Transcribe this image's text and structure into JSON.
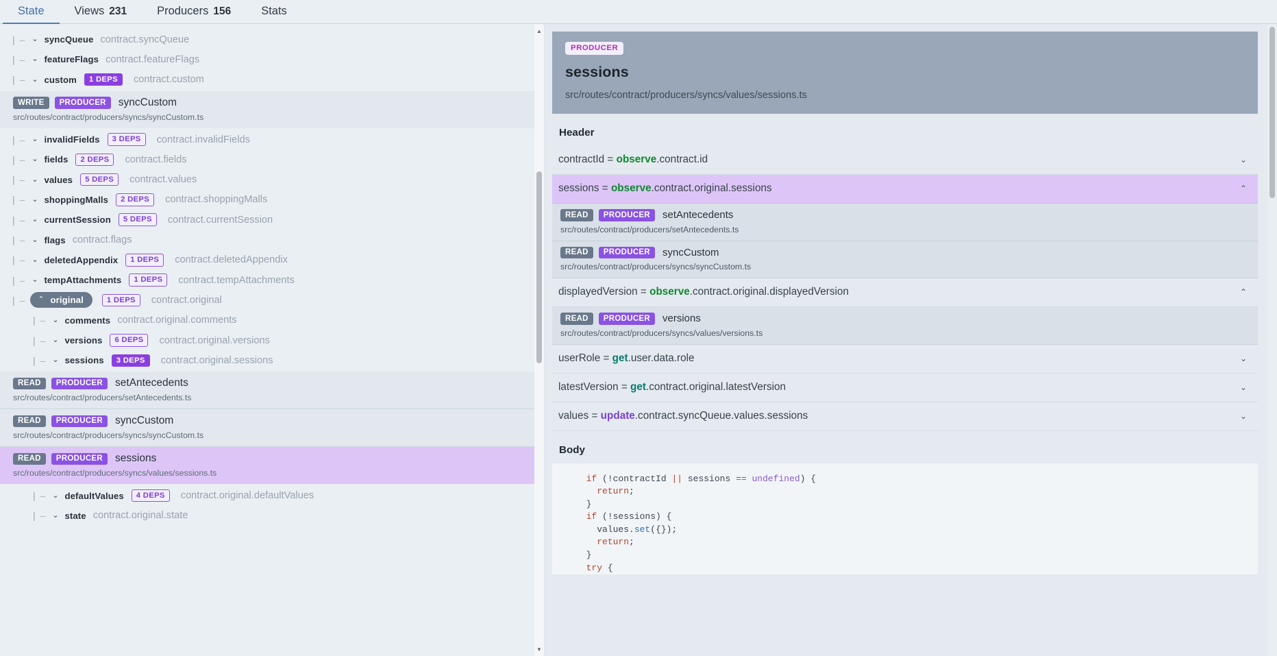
{
  "tabs": [
    {
      "label": "State",
      "count": "",
      "active": true
    },
    {
      "label": "Views",
      "count": "231",
      "active": false
    },
    {
      "label": "Producers",
      "count": "156",
      "active": false
    },
    {
      "label": "Stats",
      "count": "",
      "active": false
    }
  ],
  "tree": {
    "rows": [
      {
        "kind": "node",
        "name": "syncQueue",
        "path": "contract.syncQueue",
        "chevron": "chevron-down",
        "deps": "",
        "deps_style": "",
        "depth": 0,
        "selected": false
      },
      {
        "kind": "node",
        "name": "featureFlags",
        "path": "contract.featureFlags",
        "chevron": "chevron-down",
        "deps": "",
        "deps_style": "",
        "depth": 0,
        "selected": false
      },
      {
        "kind": "node",
        "name": "custom",
        "path": "contract.custom",
        "chevron": "chevron-down",
        "deps": "1 DEPS",
        "deps_style": "fill",
        "depth": 0,
        "selected": false
      },
      {
        "kind": "cards",
        "cards": [
          {
            "access": "WRITE",
            "role": "PRODUCER",
            "name": "syncCustom",
            "path": "src/routes/contract/producers/syncs/syncCustom.ts",
            "selected": false
          }
        ]
      },
      {
        "kind": "node",
        "name": "invalidFields",
        "path": "contract.invalidFields",
        "chevron": "chevron-down",
        "deps": "3 DEPS",
        "deps_style": "out",
        "depth": 0,
        "selected": false
      },
      {
        "kind": "node",
        "name": "fields",
        "path": "contract.fields",
        "chevron": "chevron-down",
        "deps": "2 DEPS",
        "deps_style": "out",
        "depth": 0,
        "selected": false
      },
      {
        "kind": "node",
        "name": "values",
        "path": "contract.values",
        "chevron": "chevron-down",
        "deps": "5 DEPS",
        "deps_style": "out",
        "depth": 0,
        "selected": false
      },
      {
        "kind": "node",
        "name": "shoppingMalls",
        "path": "contract.shoppingMalls",
        "chevron": "chevron-down",
        "deps": "2 DEPS",
        "deps_style": "out",
        "depth": 0,
        "selected": false
      },
      {
        "kind": "node",
        "name": "currentSession",
        "path": "contract.currentSession",
        "chevron": "chevron-down",
        "deps": "5 DEPS",
        "deps_style": "out",
        "depth": 0,
        "selected": false
      },
      {
        "kind": "node",
        "name": "flags",
        "path": "contract.flags",
        "chevron": "chevron-down",
        "deps": "",
        "deps_style": "",
        "depth": 0,
        "selected": false
      },
      {
        "kind": "node",
        "name": "deletedAppendix",
        "path": "contract.deletedAppendix",
        "chevron": "chevron-down",
        "deps": "1 DEPS",
        "deps_style": "out",
        "depth": 0,
        "selected": false
      },
      {
        "kind": "node",
        "name": "tempAttachments",
        "path": "contract.tempAttachments",
        "chevron": "chevron-down",
        "deps": "1 DEPS",
        "deps_style": "out",
        "depth": 0,
        "selected": false
      },
      {
        "kind": "node",
        "name": "original",
        "path": "contract.original",
        "chevron": "chevron-up",
        "deps": "1 DEPS",
        "deps_style": "out",
        "depth": 0,
        "selected": true
      },
      {
        "kind": "node",
        "name": "comments",
        "path": "contract.original.comments",
        "chevron": "chevron-down",
        "deps": "",
        "deps_style": "",
        "depth": 1,
        "selected": false
      },
      {
        "kind": "node",
        "name": "versions",
        "path": "contract.original.versions",
        "chevron": "chevron-down",
        "deps": "6 DEPS",
        "deps_style": "out",
        "depth": 1,
        "selected": false
      },
      {
        "kind": "node",
        "name": "sessions",
        "path": "contract.original.sessions",
        "chevron": "chevron-down",
        "deps": "3 DEPS",
        "deps_style": "fill",
        "depth": 1,
        "selected": false
      },
      {
        "kind": "cards",
        "cards": [
          {
            "access": "READ",
            "role": "PRODUCER",
            "name": "setAntecedents",
            "path": "src/routes/contract/producers/setAntecedents.ts",
            "selected": false
          },
          {
            "access": "READ",
            "role": "PRODUCER",
            "name": "syncCustom",
            "path": "src/routes/contract/producers/syncs/syncCustom.ts",
            "selected": false
          },
          {
            "access": "READ",
            "role": "PRODUCER",
            "name": "sessions",
            "path": "src/routes/contract/producers/syncs/values/sessions.ts",
            "selected": true
          }
        ]
      },
      {
        "kind": "node",
        "name": "defaultValues",
        "path": "contract.original.defaultValues",
        "chevron": "chevron-down",
        "deps": "4 DEPS",
        "deps_style": "out",
        "depth": 1,
        "selected": false
      },
      {
        "kind": "node",
        "name": "state",
        "path": "contract.original.state",
        "chevron": "chevron-down",
        "deps": "",
        "deps_style": "",
        "depth": 1,
        "selected": false
      }
    ]
  },
  "detail": {
    "badge": "PRODUCER",
    "title": "sessions",
    "subtitle": "src/routes/contract/producers/syncs/values/sessions.ts",
    "header_section_title": "Header",
    "header_rows": [
      {
        "var": "contractId",
        "eq": "=",
        "keyword": "observe",
        "keyword_kind": "observe",
        "tail": ".contract.id",
        "caret": "chevron-down",
        "expanded": false,
        "highlighted": false,
        "producers": []
      },
      {
        "var": "sessions",
        "eq": "=",
        "keyword": "observe",
        "keyword_kind": "observe",
        "tail": ".contract.original.sessions",
        "caret": "chevron-up",
        "expanded": true,
        "highlighted": true,
        "producers": [
          {
            "access": "READ",
            "role": "PRODUCER",
            "name": "setAntecedents",
            "path": "src/routes/contract/producers/setAntecedents.ts",
            "highlighted": false
          },
          {
            "access": "READ",
            "role": "PRODUCER",
            "name": "syncCustom",
            "path": "src/routes/contract/producers/syncs/syncCustom.ts",
            "highlighted": false
          }
        ]
      },
      {
        "var": "displayedVersion",
        "eq": "=",
        "keyword": "observe",
        "keyword_kind": "observe",
        "tail": ".contract.original.displayedVersion",
        "caret": "chevron-up",
        "expanded": true,
        "highlighted": false,
        "producers": [
          {
            "access": "READ",
            "role": "PRODUCER",
            "name": "versions",
            "path": "src/routes/contract/producers/syncs/values/versions.ts",
            "highlighted": false
          }
        ]
      },
      {
        "var": "userRole",
        "eq": "=",
        "keyword": "get",
        "keyword_kind": "get",
        "tail": ".user.data.role",
        "caret": "chevron-down",
        "expanded": false,
        "highlighted": false,
        "producers": []
      },
      {
        "var": "latestVersion",
        "eq": "=",
        "keyword": "get",
        "keyword_kind": "get",
        "tail": ".contract.original.latestVersion",
        "caret": "chevron-down",
        "expanded": false,
        "highlighted": false,
        "producers": []
      },
      {
        "var": "values",
        "eq": "=",
        "keyword": "update",
        "keyword_kind": "update",
        "tail": ".contract.syncQueue.values.sessions",
        "caret": "chevron-down",
        "expanded": false,
        "highlighted": false,
        "producers": []
      }
    ],
    "body_section_title": "Body",
    "code_lines": [
      [
        {
          "t": "  ",
          "c": "pl"
        },
        {
          "t": "if",
          "c": "kw"
        },
        {
          "t": " (!contractId ",
          "c": "pl"
        },
        {
          "t": "||",
          "c": "kw"
        },
        {
          "t": " sessions ",
          "c": "pl"
        },
        {
          "t": "==",
          "c": "kw"
        },
        {
          "t": " ",
          "c": "pl"
        },
        {
          "t": "undefined",
          "c": "num"
        },
        {
          "t": ") {",
          "c": "pl"
        }
      ],
      [
        {
          "t": "    ",
          "c": "pl"
        },
        {
          "t": "return",
          "c": "kw"
        },
        {
          "t": ";",
          "c": "pl"
        }
      ],
      [
        {
          "t": "  }",
          "c": "pl"
        }
      ],
      [
        {
          "t": "  ",
          "c": "pl"
        },
        {
          "t": "if",
          "c": "kw"
        },
        {
          "t": " (!sessions) {",
          "c": "pl"
        }
      ],
      [
        {
          "t": "    values.",
          "c": "pl"
        },
        {
          "t": "set",
          "c": "fn"
        },
        {
          "t": "({});",
          "c": "pl"
        }
      ],
      [
        {
          "t": "    ",
          "c": "pl"
        },
        {
          "t": "return",
          "c": "kw"
        },
        {
          "t": ";",
          "c": "pl"
        }
      ],
      [
        {
          "t": "  }",
          "c": "pl"
        }
      ],
      [
        {
          "t": "  ",
          "c": "pl"
        },
        {
          "t": "try",
          "c": "kw"
        },
        {
          "t": " {",
          "c": "pl"
        }
      ]
    ]
  }
}
